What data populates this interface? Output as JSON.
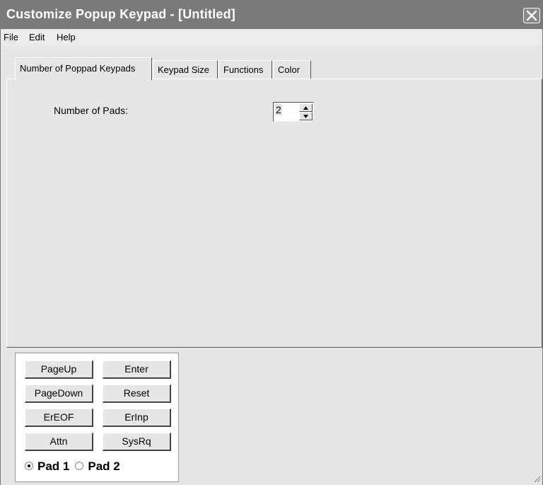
{
  "window": {
    "title": "Customize Popup Keypad - [Untitled]"
  },
  "menu": {
    "items": [
      "File",
      "Edit",
      "Help"
    ]
  },
  "tabs": [
    {
      "label": "Number of Poppad Keypads",
      "active": true
    },
    {
      "label": "Keypad Size",
      "active": false
    },
    {
      "label": "Functions",
      "active": false
    },
    {
      "label": "Color",
      "active": false
    }
  ],
  "panel": {
    "pads_label": "Number of Pads:",
    "pads_value": "2"
  },
  "keypad": {
    "buttons": [
      "PageUp",
      "Enter",
      "PageDown",
      "Reset",
      "ErEOF",
      "ErInp",
      "Attn",
      "SysRq"
    ],
    "pads": [
      {
        "label": "Pad 1",
        "selected": true
      },
      {
        "label": "Pad 2",
        "selected": false
      }
    ]
  },
  "colors": {
    "titlebar": "#7a7a7a",
    "face": "#e6e6e6"
  }
}
